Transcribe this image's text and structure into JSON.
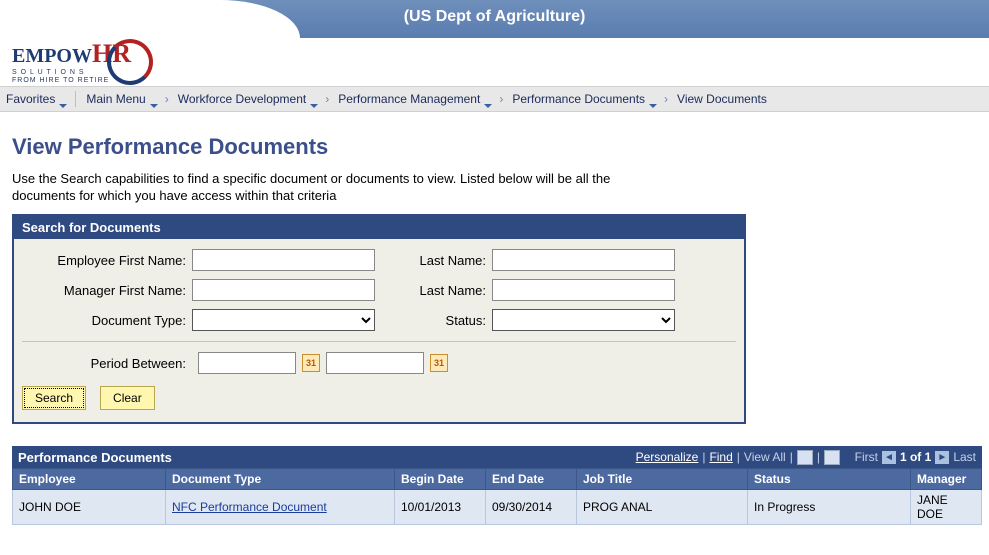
{
  "header": {
    "org_title": "(US Dept of Agriculture)",
    "logo_main_a": "EMPOW",
    "logo_main_b": "HR",
    "logo_sub1": "S O L U T I O N S",
    "logo_sub2": "FROM HIRE TO RETIRE"
  },
  "breadcrumb": {
    "favorites": "Favorites",
    "main_menu": "Main Menu",
    "items": [
      "Workforce Development",
      "Performance Management",
      "Performance Documents",
      "View Documents"
    ]
  },
  "page": {
    "title": "View Performance Documents",
    "instructions": "Use the Search capabilities to find a specific document or documents to view. Listed below will be all the documents for which you have access within that criteria"
  },
  "search": {
    "box_title": "Search for Documents",
    "labels": {
      "emp_first": "Employee First Name:",
      "emp_last": "Last Name:",
      "mgr_first": "Manager First Name:",
      "mgr_last": "Last Name:",
      "doc_type": "Document Type:",
      "status": "Status:",
      "period": "Period Between:"
    },
    "values": {
      "emp_first": "",
      "emp_last": "",
      "mgr_first": "",
      "mgr_last": "",
      "doc_type": "",
      "status": "",
      "period_from": "",
      "period_to": ""
    },
    "buttons": {
      "search": "Search",
      "clear": "Clear"
    }
  },
  "grid": {
    "title": "Performance Documents",
    "tools": {
      "personalize": "Personalize",
      "find": "Find",
      "view_all": "View All",
      "first": "First",
      "position": "1 of 1",
      "last": "Last"
    },
    "columns": [
      "Employee",
      "Document Type",
      "Begin Date",
      "End Date",
      "Job Title",
      "Status",
      "Manager"
    ],
    "rows": [
      {
        "employee": "JOHN DOE",
        "doc_type": "NFC Performance Document",
        "begin": "10/01/2013",
        "end": "09/30/2014",
        "job": "PROG ANAL",
        "status": "In Progress",
        "manager": "JANE DOE"
      }
    ]
  }
}
